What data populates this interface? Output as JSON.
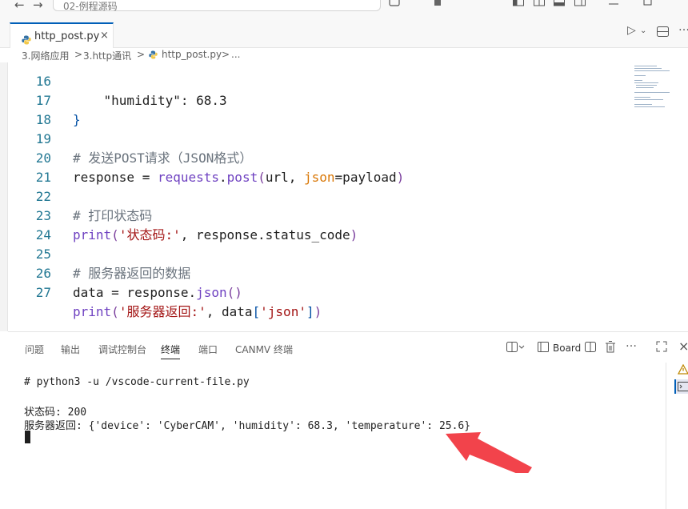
{
  "titlebar": {
    "command_center_text": "02-例程源码",
    "back_icon": "arrow-left-icon",
    "forward_icon": "arrow-right-icon"
  },
  "tab": {
    "label": "http_post.py",
    "close_glyph": "×",
    "icon": "python-file-icon"
  },
  "editor_actions": {
    "run_glyph": "▷",
    "run_dropdown_glyph": "⌄",
    "split_icon": "split-editor-icon",
    "more_glyph": "…"
  },
  "breadcrumb": {
    "items": [
      "3.网络应用",
      "3.http通讯",
      "http_post.py",
      "..."
    ],
    "separator": ">"
  },
  "code_lines": [
    {
      "num": "16",
      "text": "    \"humidity\": 68.3"
    },
    {
      "num": "17",
      "text": "}"
    },
    {
      "num": "18",
      "text": ""
    },
    {
      "num": "19",
      "text": "# 发送POST请求（JSON格式）"
    },
    {
      "num": "20",
      "parts": [
        "response",
        " = ",
        "requests",
        ".",
        "post",
        "(",
        "url, ",
        "json",
        "=payload",
        ")"
      ]
    },
    {
      "num": "21",
      "text": ""
    },
    {
      "num": "22",
      "text": "# 打印状态码"
    },
    {
      "num": "23",
      "parts": [
        "print",
        "(",
        "'状态码:'",
        ", response.status_code",
        ")"
      ]
    },
    {
      "num": "24",
      "text": ""
    },
    {
      "num": "25",
      "text": "# 服务器返回的数据"
    },
    {
      "num": "26",
      "parts": [
        "data",
        " = response.",
        "json",
        "(",
        ")"
      ]
    },
    {
      "num": "27",
      "parts": [
        "print",
        "(",
        "'服务器返回:'",
        ", data",
        "[",
        "'json'",
        "]",
        ")"
      ]
    }
  ],
  "panel": {
    "tabs": [
      "问题",
      "输出",
      "调试控制台",
      "终端",
      "端口",
      "CANMV 终端"
    ],
    "active_tab": "终端",
    "board_label": "Board",
    "more_glyph": "…",
    "close_glyph": "×"
  },
  "terminal": {
    "lines": [
      "# python3 -u /vscode-current-file.py",
      "",
      "状态码: 200",
      "服务器返回: {'device': 'CyberCAM', 'humidity': 68.3, 'temperature': 25.6}"
    ]
  },
  "colors": {
    "accent": "#005fb8",
    "arrow": "#f2434b",
    "comment": "#6a737d",
    "function": "#6f42c1",
    "string": "#a31515"
  }
}
